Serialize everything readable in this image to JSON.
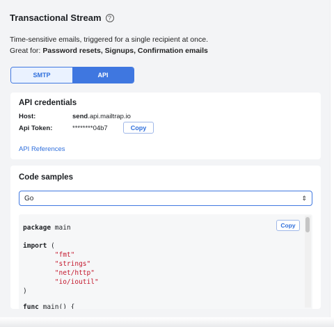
{
  "header": {
    "title": "Transactional Stream",
    "help_icon": "help-circle-icon",
    "description": "Time-sensitive emails, triggered for a single recipient at once.",
    "great_for_label": "Great for:",
    "great_for_value": "Password resets, Signups, Confirmation emails"
  },
  "tabs": [
    {
      "label": "SMTP",
      "selected": false
    },
    {
      "label": "API",
      "selected": true
    }
  ],
  "credentials": {
    "title": "API credentials",
    "host_label": "Host:",
    "host_value_bold": "send",
    "host_value_rest": ".api.mailtrap.io",
    "token_label": "Api Token:",
    "token_value": "********04b7",
    "copy_label": "Copy",
    "references_link": "API References"
  },
  "code_samples": {
    "title": "Code samples",
    "language_selected": "Go",
    "copy_label": "Copy",
    "lines": {
      "l1_kw": "package",
      "l1_rest": " main",
      "l2_kw": "import",
      "l2_rest": " (",
      "l3": "        \"fmt\"",
      "l4": "        \"strings\"",
      "l5": "        \"net/http\"",
      "l6": "        \"io/ioutil\"",
      "l7": ")",
      "l8_kw": "func",
      "l8_rest": " main() {"
    }
  },
  "colors": {
    "accent": "#3f77e0",
    "link": "#2f6fdc",
    "string": "#c4182d",
    "panel_bg": "#f3f4f6"
  }
}
